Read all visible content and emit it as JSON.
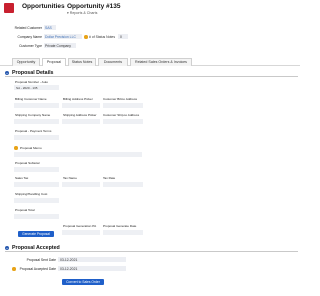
{
  "header": {
    "title": "Opportunities",
    "separator": "›",
    "opportunity": "Opportunity #135",
    "subtitle": "▾ Reports & Charts"
  },
  "info": {
    "related_customer_label": "Related Customer",
    "related_customer_value": "SAS",
    "company_name_label": "Company Name",
    "company_name_value": "Dollar Precision LLC",
    "status_notes_label": "# of Status Notes",
    "status_notes_value": "0",
    "customer_type_label": "Customer Type",
    "customer_type_value": "Private Company"
  },
  "tabs": [
    {
      "label": "Opportunity"
    },
    {
      "label": "Proposal"
    },
    {
      "label": "Status Notes"
    },
    {
      "label": "Documents"
    },
    {
      "label": "Related Sales Orders & Invoices"
    }
  ],
  "proposal_details": {
    "title": "Proposal Details",
    "proposal_number_label": "Proposal Number - Auto",
    "proposal_number_value": "SA - 2020 - 135",
    "billing_customer_name": "Billing Customer Name",
    "billing_address_picker": "Billing Address Picker",
    "customer_bill_to_address": "Customer Bill-to Address",
    "shipping_company_name": "Shipping Company Name",
    "shipping_address_picker": "Shipping Address Picker",
    "customer_ship_to_address": "Customer Ship-to Address",
    "payment_terms": "Proposal - Payment Terms",
    "proposal_memo": "Proposal Memo",
    "proposal_subtotal": "Proposal Subtotal",
    "sales_tax": "Sales Tax",
    "tax_name": "Tax Name",
    "tax_rate": "Tax Rate",
    "shipping_handling_cost": "Shipping/Handling Cost",
    "proposal_total": "Proposal Total",
    "generation_pa": "Proposal Generation PA",
    "generate_date": "Proposal Generate Date",
    "generate_button": "Generate Proposal"
  },
  "proposal_accepted": {
    "title": "Proposal Accepted",
    "sent_date_label": "Proposal Sent Date",
    "sent_date_value": "03-12-2021",
    "accepted_date_label": "Proposal Accepted Date",
    "accepted_date_value": "03-12-2021",
    "convert_button": "Convert to Sales Order"
  },
  "colors": {
    "brand_red": "#c8202f",
    "link_blue": "#3d6fb5",
    "button_blue": "#1f5fc9",
    "required_dot": "#e8a317"
  }
}
